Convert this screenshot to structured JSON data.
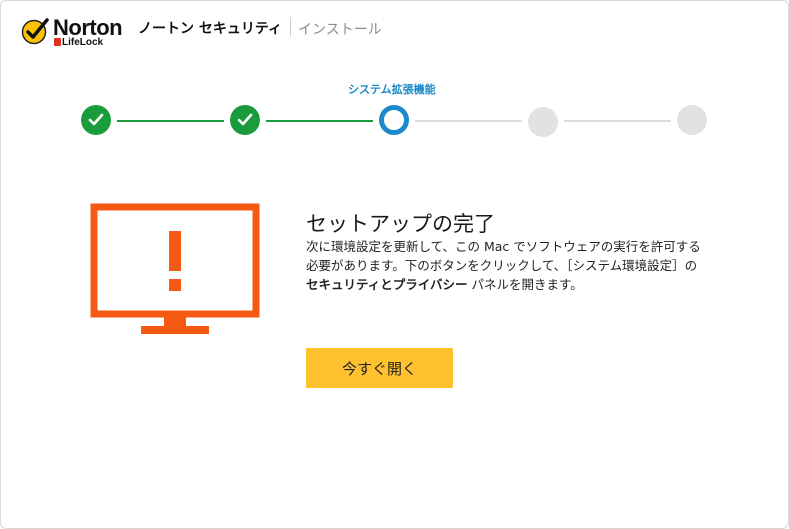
{
  "header": {
    "brand": "Norton",
    "sub_brand": "LifeLock",
    "product": "ノートン セキュリティ",
    "current_phase": "インストール"
  },
  "stepper": {
    "active_label": "システム拡張機能",
    "total_steps": 5,
    "current_step": 3,
    "colors": {
      "done": "#1a9c3c",
      "current": "#1b8ac8",
      "pending": "#e2e2e2"
    }
  },
  "main": {
    "title": "セットアップの完了",
    "body_part1": "次に環境設定を更新して、この Mac でソフトウェアの実行を許可する必要があります。下のボタンをクリックして、［システム環境設定］の ",
    "body_bold": "セキュリティとプライバシー",
    "body_part2": " パネルを開きます。",
    "button_label": "今すぐ開く",
    "button_color": "#ffc22e",
    "alert_color": "#f55a12",
    "alert_icon": "monitor-warning-icon"
  }
}
